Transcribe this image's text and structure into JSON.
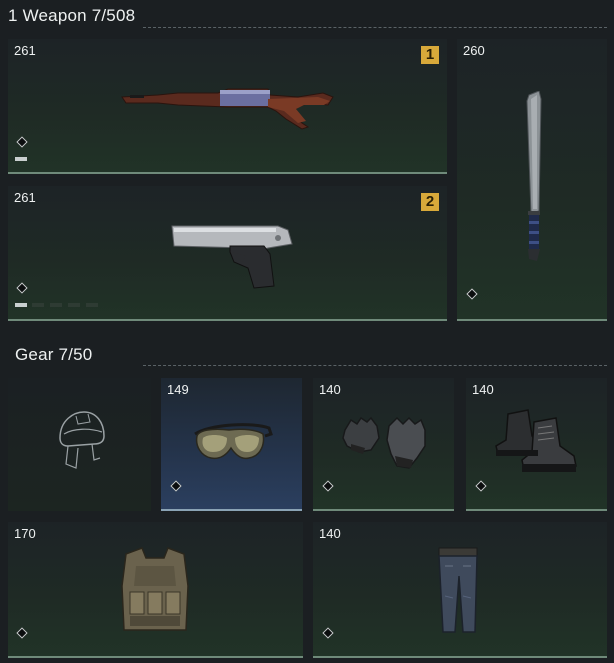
{
  "weapons": {
    "title": "1 Weapon 7/508",
    "primary1": {
      "count": "261",
      "slot": "1",
      "item": "rifle-icon"
    },
    "primary2": {
      "count": "261",
      "slot": "2",
      "item": "pistol-icon"
    },
    "melee": {
      "count": "260",
      "item": "machete-icon"
    }
  },
  "gear": {
    "title": "Gear 7/50",
    "slots": [
      {
        "name": "helmet",
        "count": "",
        "item": "helmet-outline-icon"
      },
      {
        "name": "goggles",
        "count": "149",
        "item": "goggles-icon"
      },
      {
        "name": "gloves",
        "count": "140",
        "item": "gloves-icon"
      },
      {
        "name": "boots",
        "count": "140",
        "item": "boots-icon"
      },
      {
        "name": "vest",
        "count": "170",
        "item": "vest-icon"
      },
      {
        "name": "pants",
        "count": "140",
        "item": "pants-icon"
      }
    ]
  },
  "colors": {
    "badge": "#d8a93a",
    "rarity_blue": "#2b3f5f",
    "slot_green": "#213327"
  }
}
